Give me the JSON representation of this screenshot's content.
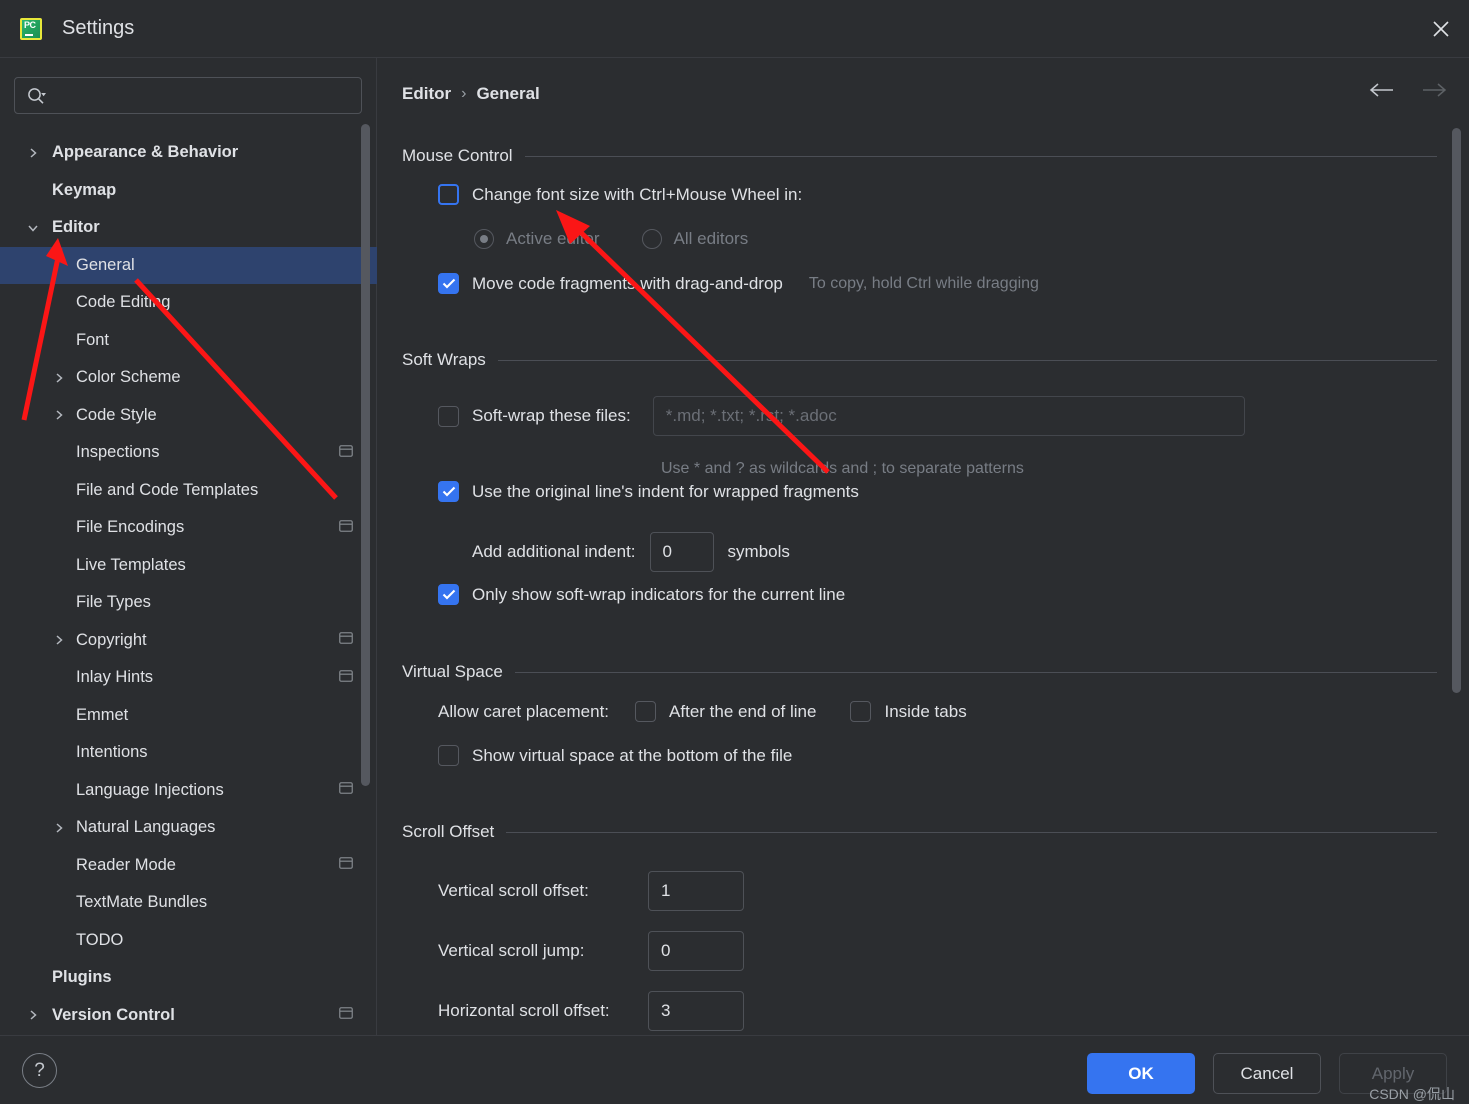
{
  "window": {
    "title": "Settings",
    "app_icon": "pycharm-icon",
    "close_label": "×"
  },
  "sidebar": {
    "search": {
      "placeholder": "",
      "value": ""
    },
    "items": [
      {
        "label": "Appearance & Behavior",
        "level": 0,
        "arrow": "collapsed",
        "bold": true,
        "badge": false,
        "selected": false
      },
      {
        "label": "Keymap",
        "level": 0,
        "arrow": "none",
        "bold": true,
        "badge": false,
        "selected": false
      },
      {
        "label": "Editor",
        "level": 0,
        "arrow": "expanded",
        "bold": true,
        "badge": false,
        "selected": false
      },
      {
        "label": "General",
        "level": 1,
        "arrow": "none",
        "bold": false,
        "badge": false,
        "selected": true
      },
      {
        "label": "Code Editing",
        "level": 1,
        "arrow": "none",
        "bold": false,
        "badge": false,
        "selected": false
      },
      {
        "label": "Font",
        "level": 1,
        "arrow": "none",
        "bold": false,
        "badge": false,
        "selected": false
      },
      {
        "label": "Color Scheme",
        "level": 1,
        "arrow": "collapsed",
        "bold": false,
        "badge": false,
        "selected": false
      },
      {
        "label": "Code Style",
        "level": 1,
        "arrow": "collapsed",
        "bold": false,
        "badge": false,
        "selected": false
      },
      {
        "label": "Inspections",
        "level": 1,
        "arrow": "none",
        "bold": false,
        "badge": true,
        "selected": false
      },
      {
        "label": "File and Code Templates",
        "level": 1,
        "arrow": "none",
        "bold": false,
        "badge": false,
        "selected": false
      },
      {
        "label": "File Encodings",
        "level": 1,
        "arrow": "none",
        "bold": false,
        "badge": true,
        "selected": false
      },
      {
        "label": "Live Templates",
        "level": 1,
        "arrow": "none",
        "bold": false,
        "badge": false,
        "selected": false
      },
      {
        "label": "File Types",
        "level": 1,
        "arrow": "none",
        "bold": false,
        "badge": false,
        "selected": false
      },
      {
        "label": "Copyright",
        "level": 1,
        "arrow": "collapsed",
        "bold": false,
        "badge": true,
        "selected": false
      },
      {
        "label": "Inlay Hints",
        "level": 1,
        "arrow": "none",
        "bold": false,
        "badge": true,
        "selected": false
      },
      {
        "label": "Emmet",
        "level": 1,
        "arrow": "none",
        "bold": false,
        "badge": false,
        "selected": false
      },
      {
        "label": "Intentions",
        "level": 1,
        "arrow": "none",
        "bold": false,
        "badge": false,
        "selected": false
      },
      {
        "label": "Language Injections",
        "level": 1,
        "arrow": "none",
        "bold": false,
        "badge": true,
        "selected": false
      },
      {
        "label": "Natural Languages",
        "level": 1,
        "arrow": "collapsed",
        "bold": false,
        "badge": false,
        "selected": false
      },
      {
        "label": "Reader Mode",
        "level": 1,
        "arrow": "none",
        "bold": false,
        "badge": true,
        "selected": false
      },
      {
        "label": "TextMate Bundles",
        "level": 1,
        "arrow": "none",
        "bold": false,
        "badge": false,
        "selected": false
      },
      {
        "label": "TODO",
        "level": 1,
        "arrow": "none",
        "bold": false,
        "badge": false,
        "selected": false
      },
      {
        "label": "Plugins",
        "level": 0,
        "arrow": "none",
        "bold": true,
        "badge": false,
        "selected": false
      },
      {
        "label": "Version Control",
        "level": 0,
        "arrow": "collapsed",
        "bold": true,
        "badge": true,
        "selected": false
      }
    ]
  },
  "breadcrumb": {
    "parent": "Editor",
    "separator": "›",
    "current": "General"
  },
  "nav": {
    "back": "back-arrow",
    "forward": "forward-arrow"
  },
  "sections": {
    "mouse_control": {
      "title": "Mouse Control",
      "change_font_size": {
        "label": "Change font size with Ctrl+Mouse Wheel in:",
        "checked": false
      },
      "scope_active": {
        "label": "Active editor",
        "selected": true
      },
      "scope_all": {
        "label": "All editors",
        "selected": false
      },
      "drag_drop": {
        "label": "Move code fragments with drag-and-drop",
        "checked": true
      },
      "drag_drop_hint": "To copy, hold Ctrl while dragging"
    },
    "soft_wraps": {
      "title": "Soft Wraps",
      "soft_wrap_files": {
        "label": "Soft-wrap these files:",
        "checked": false
      },
      "files_placeholder": "*.md; *.txt; *.rst; *.adoc",
      "files_value": "",
      "wildcards_hint": "Use * and ? as wildcards and ; to separate patterns",
      "original_indent": {
        "label": "Use the original line's indent for wrapped fragments",
        "checked": true
      },
      "add_indent_label": "Add additional indent:",
      "add_indent_value": "0",
      "symbols_label": "symbols",
      "only_current_line": {
        "label": "Only show soft-wrap indicators for the current line",
        "checked": true
      }
    },
    "virtual_space": {
      "title": "Virtual Space",
      "caret_label": "Allow caret placement:",
      "after_eol": {
        "label": "After the end of line",
        "checked": false
      },
      "inside_tabs": {
        "label": "Inside tabs",
        "checked": false
      },
      "show_virtual_space": {
        "label": "Show virtual space at the bottom of the file",
        "checked": false
      }
    },
    "scroll_offset": {
      "title": "Scroll Offset",
      "vertical_offset_label": "Vertical scroll offset:",
      "vertical_offset_value": "1",
      "vertical_jump_label": "Vertical scroll jump:",
      "vertical_jump_value": "0",
      "horizontal_offset_label": "Horizontal scroll offset:",
      "horizontal_offset_value": "3"
    }
  },
  "footer": {
    "help": "?",
    "ok": "OK",
    "cancel": "Cancel",
    "apply": "Apply",
    "watermark": "CSDN @侃山"
  },
  "colors": {
    "accent": "#3574f0",
    "selection": "#2e436e",
    "background": "#2b2d30",
    "annotation": "#fb1616"
  }
}
